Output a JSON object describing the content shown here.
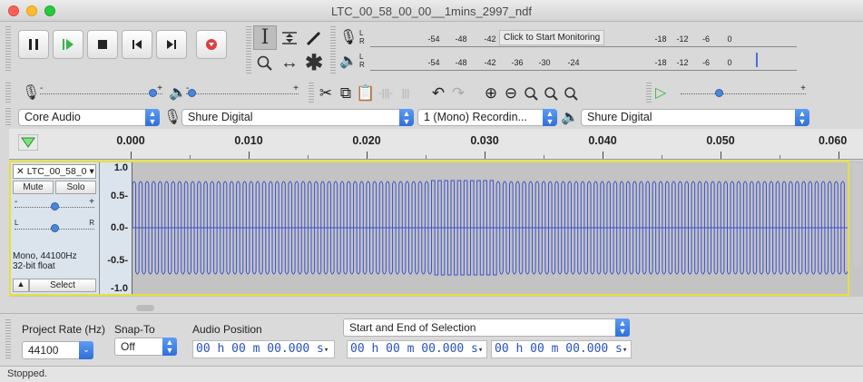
{
  "window": {
    "title": "LTC_00_58_00_00__1mins_2997_ndf"
  },
  "meters": {
    "record_scale": [
      "-54",
      "-48",
      "-42",
      "-18",
      "-12",
      "-6",
      "0"
    ],
    "monitor_label": "Click to Start Monitoring",
    "playback_scale": [
      "-54",
      "-48",
      "-42",
      "-36",
      "-30",
      "-24",
      "-18",
      "-12",
      "-6",
      "0"
    ],
    "channel_left": "L",
    "channel_right": "R"
  },
  "sliders": {
    "plus": "+",
    "minus": "-"
  },
  "devices": {
    "host": "Core Audio",
    "recording_device": "Shure Digital",
    "recording_channels": "1 (Mono) Recordin...",
    "playback_device": "Shure Digital"
  },
  "timeline": {
    "labels": [
      "0.000",
      "0.010",
      "0.020",
      "0.030",
      "0.040",
      "0.050",
      "0.060"
    ]
  },
  "track": {
    "name": "LTC_00_58_0",
    "mute_label": "Mute",
    "solo_label": "Solo",
    "gain_minus": "-",
    "gain_plus": "+",
    "pan_left": "L",
    "pan_right": "R",
    "format_line1": "Mono, 44100Hz",
    "format_line2": "32-bit float",
    "select_label": "Select",
    "vruler": [
      "1.0",
      "0.5-",
      "0.0-",
      "-0.5-",
      "-1.0"
    ],
    "wave_color": "#3b4fd0",
    "cycles": 110
  },
  "selection_toolbar": {
    "project_rate_label": "Project Rate (Hz)",
    "project_rate_value": "44100",
    "snap_to_label": "Snap-To",
    "snap_to_value": "Off",
    "audio_position_label": "Audio Position",
    "selection_mode": "Start and End of Selection",
    "time_audio_position": "00 h 00 m 00.000 s",
    "time_selection_start": "00 h 00 m 00.000 s",
    "time_selection_end": "00 h 00 m 00.000 s"
  },
  "status": {
    "text": "Stopped."
  },
  "colors": {
    "accent": "#2e6fd9",
    "track_border": "#e6e03a",
    "record": "#d94040",
    "play": "#39b54a"
  }
}
